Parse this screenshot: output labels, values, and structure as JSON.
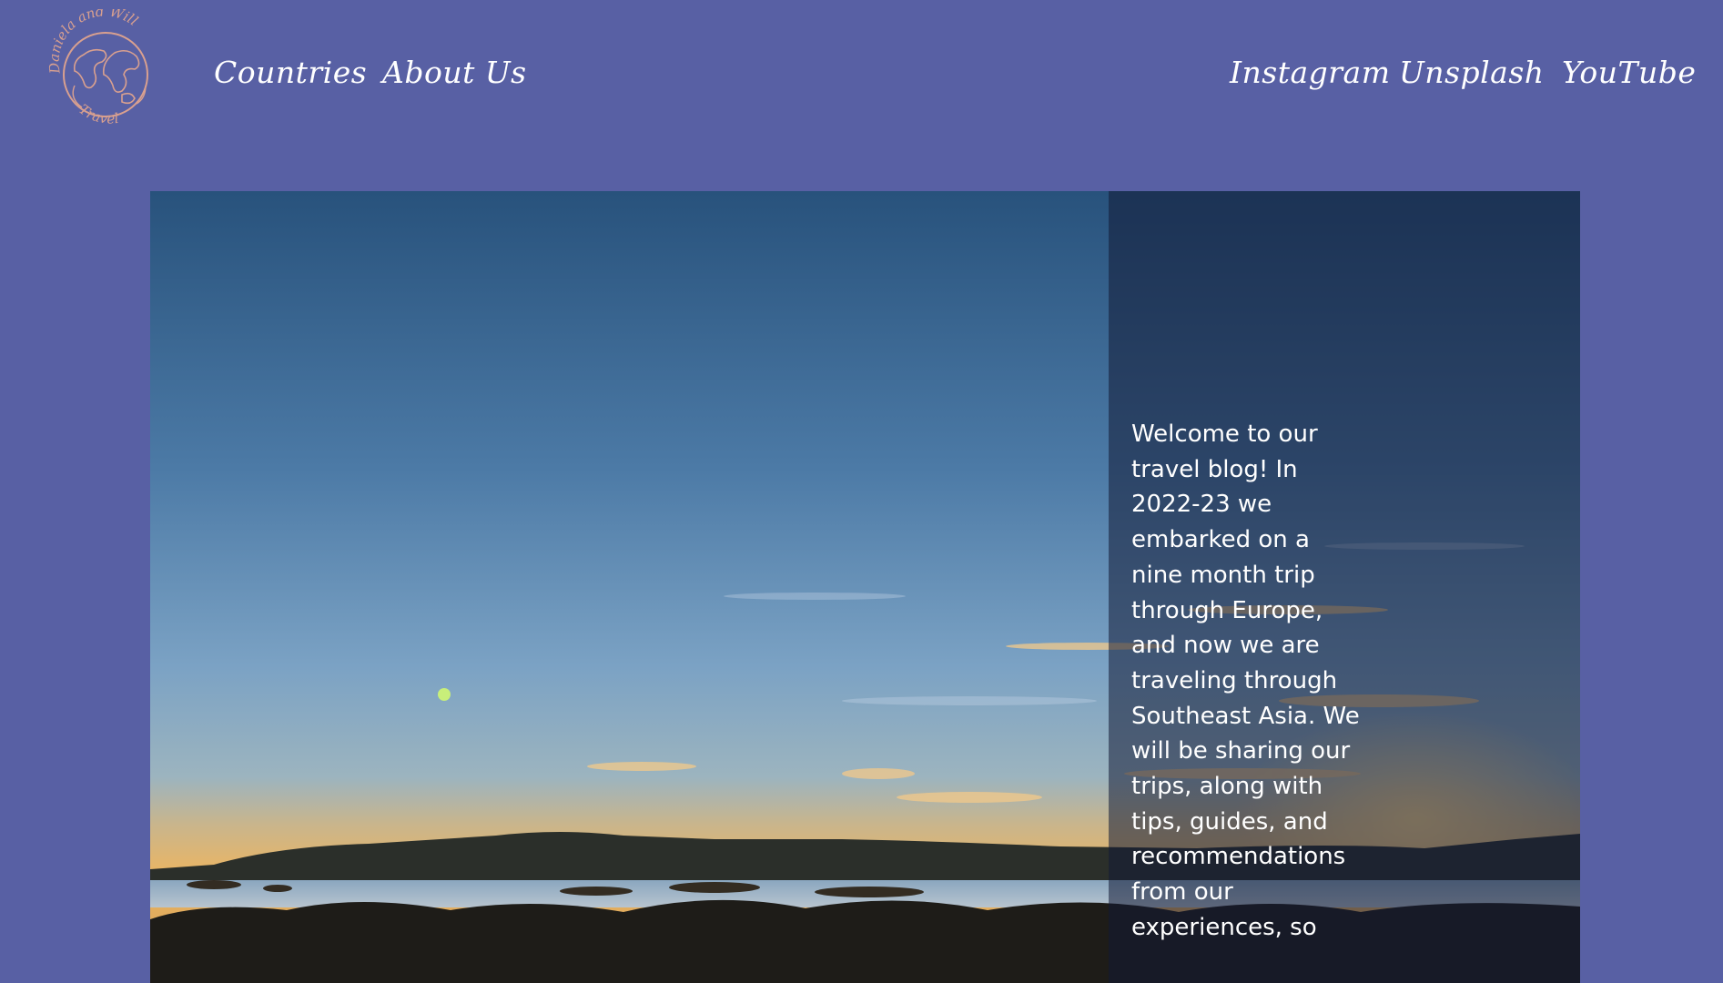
{
  "header": {
    "logo": {
      "icon": "globe-logo-icon",
      "text_top": "Daniela and Will",
      "text_bottom": "Travel"
    },
    "nav_left": [
      {
        "label": "Countries"
      },
      {
        "label": "About Us"
      }
    ],
    "nav_right": [
      {
        "label": "Instagram"
      },
      {
        "label": "Unsplash"
      },
      {
        "label": "YouTube"
      }
    ]
  },
  "hero": {
    "image": "sunset-coastline-photo",
    "welcome_text": "Welcome to our travel blog! In 2022-23 we embarked on a nine month trip through Europe, and now we are traveling through Southeast Asia. We will be sharing our trips, along with tips, guides, and recommendations from our experiences, so"
  },
  "colors": {
    "background": "#5860a4",
    "nav_text": "#ffffff",
    "logo_stroke": "#d9a08f",
    "overlay": "rgba(18,26,52,0.55)"
  }
}
